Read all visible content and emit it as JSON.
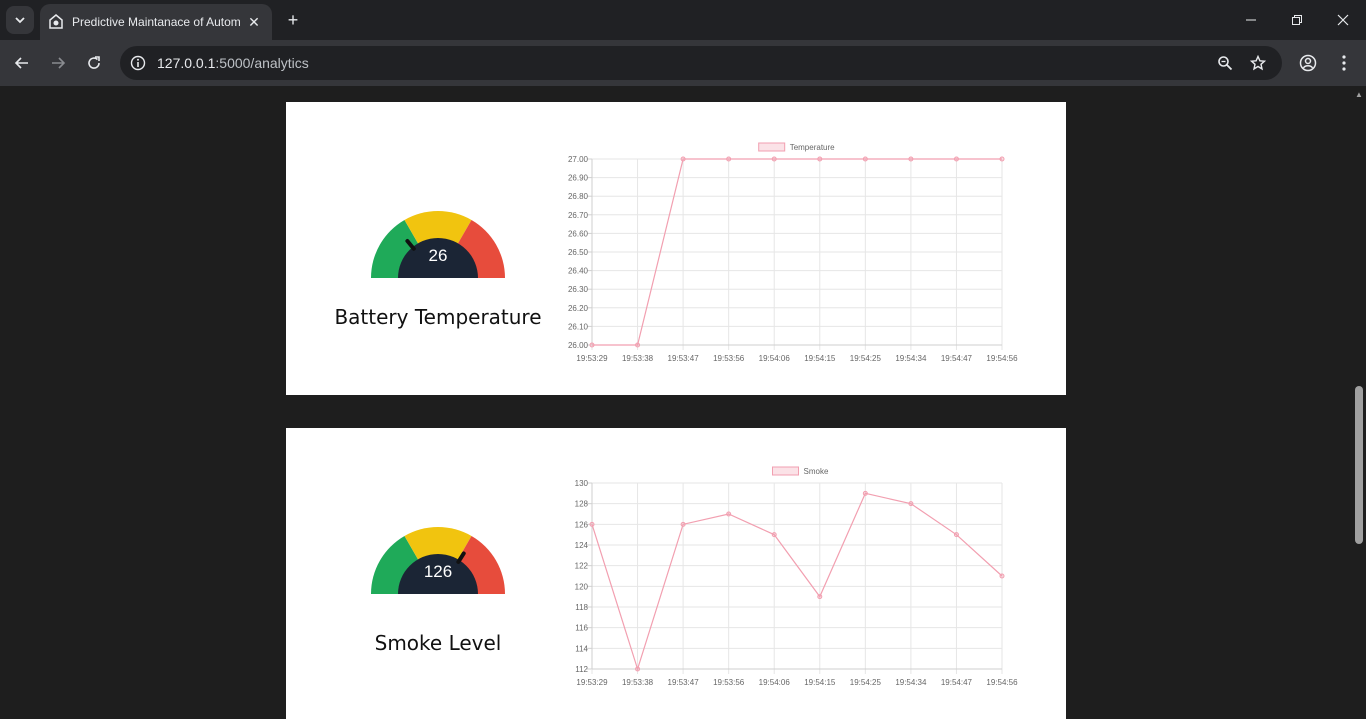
{
  "browser": {
    "tab_title": "Predictive Maintanace of Autom",
    "url_host": "127.0.0.1",
    "url_path": ":5000/analytics",
    "icons": [
      "tab-search-icon",
      "app-favicon",
      "close-icon",
      "plus-icon",
      "minimize-icon",
      "restore-icon",
      "close-window-icon",
      "back-icon",
      "forward-icon",
      "reload-icon",
      "site-info-icon",
      "zoom-icon",
      "bookmark-star-icon",
      "profile-icon",
      "kebab-menu-icon"
    ]
  },
  "cards": [
    {
      "label": "Battery Temperature",
      "gauge_value": "26",
      "gauge_level": 0.28,
      "chart_data": {
        "type": "line",
        "legend": "Temperature",
        "legend_position": "top-center",
        "categories": [
          "19:53:29",
          "19:53:38",
          "19:53:47",
          "19:53:56",
          "19:54:06",
          "19:54:15",
          "19:54:25",
          "19:54:34",
          "19:54:47",
          "19:54:56"
        ],
        "series": [
          {
            "name": "Temperature",
            "values": [
              26.0,
              26.0,
              27.0,
              27.0,
              27.0,
              27.0,
              27.0,
              27.0,
              27.0,
              27.0
            ]
          }
        ],
        "yticks": [
          "26.00",
          "26.10",
          "26.20",
          "26.30",
          "26.40",
          "26.50",
          "26.60",
          "26.70",
          "26.80",
          "26.90",
          "27.00"
        ],
        "ylim": [
          26.0,
          27.0
        ],
        "grid": true,
        "color": "#f29fb0"
      }
    },
    {
      "label": "Smoke Level",
      "gauge_value": "126",
      "gauge_level": 0.68,
      "chart_data": {
        "type": "line",
        "legend": "Smoke",
        "legend_position": "top-center",
        "categories": [
          "19:53:29",
          "19:53:38",
          "19:53:47",
          "19:53:56",
          "19:54:06",
          "19:54:15",
          "19:54:25",
          "19:54:34",
          "19:54:47",
          "19:54:56"
        ],
        "series": [
          {
            "name": "Smoke",
            "values": [
              126,
              112,
              126,
              127,
              125,
              119,
              129,
              128,
              125,
              121
            ]
          }
        ],
        "yticks": [
          "112",
          "114",
          "116",
          "118",
          "120",
          "122",
          "124",
          "126",
          "128",
          "130"
        ],
        "ylim": [
          112,
          130
        ],
        "grid": true,
        "color": "#f29fb0"
      }
    }
  ],
  "colors": {
    "gauge_green": "#1faa59",
    "gauge_yellow": "#f1c40f",
    "gauge_red": "#e74c3c",
    "gauge_center": "#1b2535",
    "line": "#f29fb0"
  }
}
